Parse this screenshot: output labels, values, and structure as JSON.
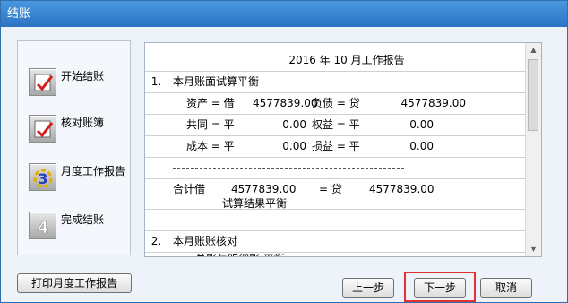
{
  "window": {
    "title": "结账"
  },
  "steps": [
    {
      "label": "开始结账",
      "icon": "checkmark-icon"
    },
    {
      "label": "核对账簿",
      "icon": "checkmark-icon"
    },
    {
      "label": "月度工作报告",
      "icon": "step-3-icon",
      "number": "3"
    },
    {
      "label": "完成结账",
      "icon": "step-4-icon",
      "number": "4"
    }
  ],
  "report": {
    "title": "2016 年 10 月工作报告",
    "section1": {
      "num": "1.",
      "heading": "本月账面试算平衡",
      "rows": [
        {
          "a_label": "资产 = 借",
          "a_value": "4577839.00",
          "b_label": "负债 = 贷",
          "b_value": "4577839.00"
        },
        {
          "a_label": "共同 = 平",
          "a_value": "0.00",
          "b_label": "权益 = 平",
          "b_value": "0.00"
        },
        {
          "a_label": "成本 = 平",
          "a_value": "0.00",
          "b_label": "损益 = 平",
          "b_value": "0.00"
        }
      ],
      "dashes": "------------------------------------------------",
      "total_label": "合计借",
      "total_debit": "4577839.00",
      "total_eq": "= 贷",
      "total_credit": "4577839.00",
      "result": "试算结果平衡"
    },
    "section2": {
      "num": "2.",
      "heading": "本月账账核对",
      "partial": "总账与明细账 平衡"
    }
  },
  "buttons": {
    "print": "打印月度工作报告",
    "prev": "上一步",
    "next": "下一步",
    "cancel": "取消"
  },
  "colors": {
    "highlight": "#e03030",
    "titlebar": "#2b74c4"
  }
}
